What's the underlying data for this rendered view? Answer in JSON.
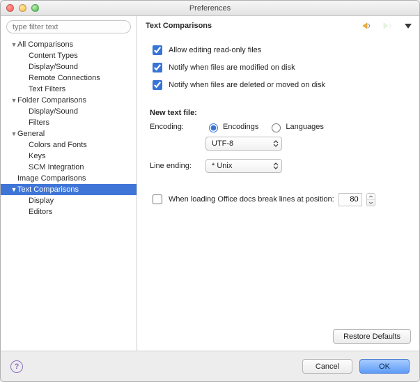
{
  "window": {
    "title": "Preferences"
  },
  "sidebar": {
    "filter_placeholder": "type filter text",
    "items": [
      {
        "label": "All Comparisons",
        "level": 1,
        "arrow": true
      },
      {
        "label": "Content Types",
        "level": 2
      },
      {
        "label": "Display/Sound",
        "level": 2
      },
      {
        "label": "Remote Connections",
        "level": 2
      },
      {
        "label": "Text Filters",
        "level": 2
      },
      {
        "label": "Folder Comparisons",
        "level": 1,
        "arrow": true
      },
      {
        "label": "Display/Sound",
        "level": 2
      },
      {
        "label": "Filters",
        "level": 2
      },
      {
        "label": "General",
        "level": 1,
        "arrow": true
      },
      {
        "label": "Colors and Fonts",
        "level": 2
      },
      {
        "label": "Keys",
        "level": 2
      },
      {
        "label": "SCM Integration",
        "level": 2
      },
      {
        "label": "Image Comparisons",
        "level": 1
      },
      {
        "label": "Text Comparisons",
        "level": 1,
        "arrow": true,
        "selected": true
      },
      {
        "label": "Display",
        "level": 2
      },
      {
        "label": "Editors",
        "level": 2
      }
    ]
  },
  "panel": {
    "title": "Text Comparisons",
    "checkboxes": {
      "allow_edit_ro": {
        "label": "Allow editing read-only files",
        "checked": true
      },
      "notify_modified": {
        "label": "Notify when files are modified on disk",
        "checked": true
      },
      "notify_deleted": {
        "label": "Notify when files are deleted or moved on disk",
        "checked": true
      }
    },
    "new_text_file_label": "New text file:",
    "encoding_label": "Encoding:",
    "line_ending_label": "Line ending:",
    "encoding_mode": {
      "encodings_label": "Encodings",
      "languages_label": "Languages",
      "value": "encodings"
    },
    "encoding_value": "UTF-8",
    "line_ending_value": "* Unix",
    "office": {
      "label": "When loading Office docs break lines at position:",
      "checked": false,
      "value": "80"
    },
    "restore_defaults": "Restore Defaults"
  },
  "footer": {
    "cancel": "Cancel",
    "ok": "OK"
  }
}
